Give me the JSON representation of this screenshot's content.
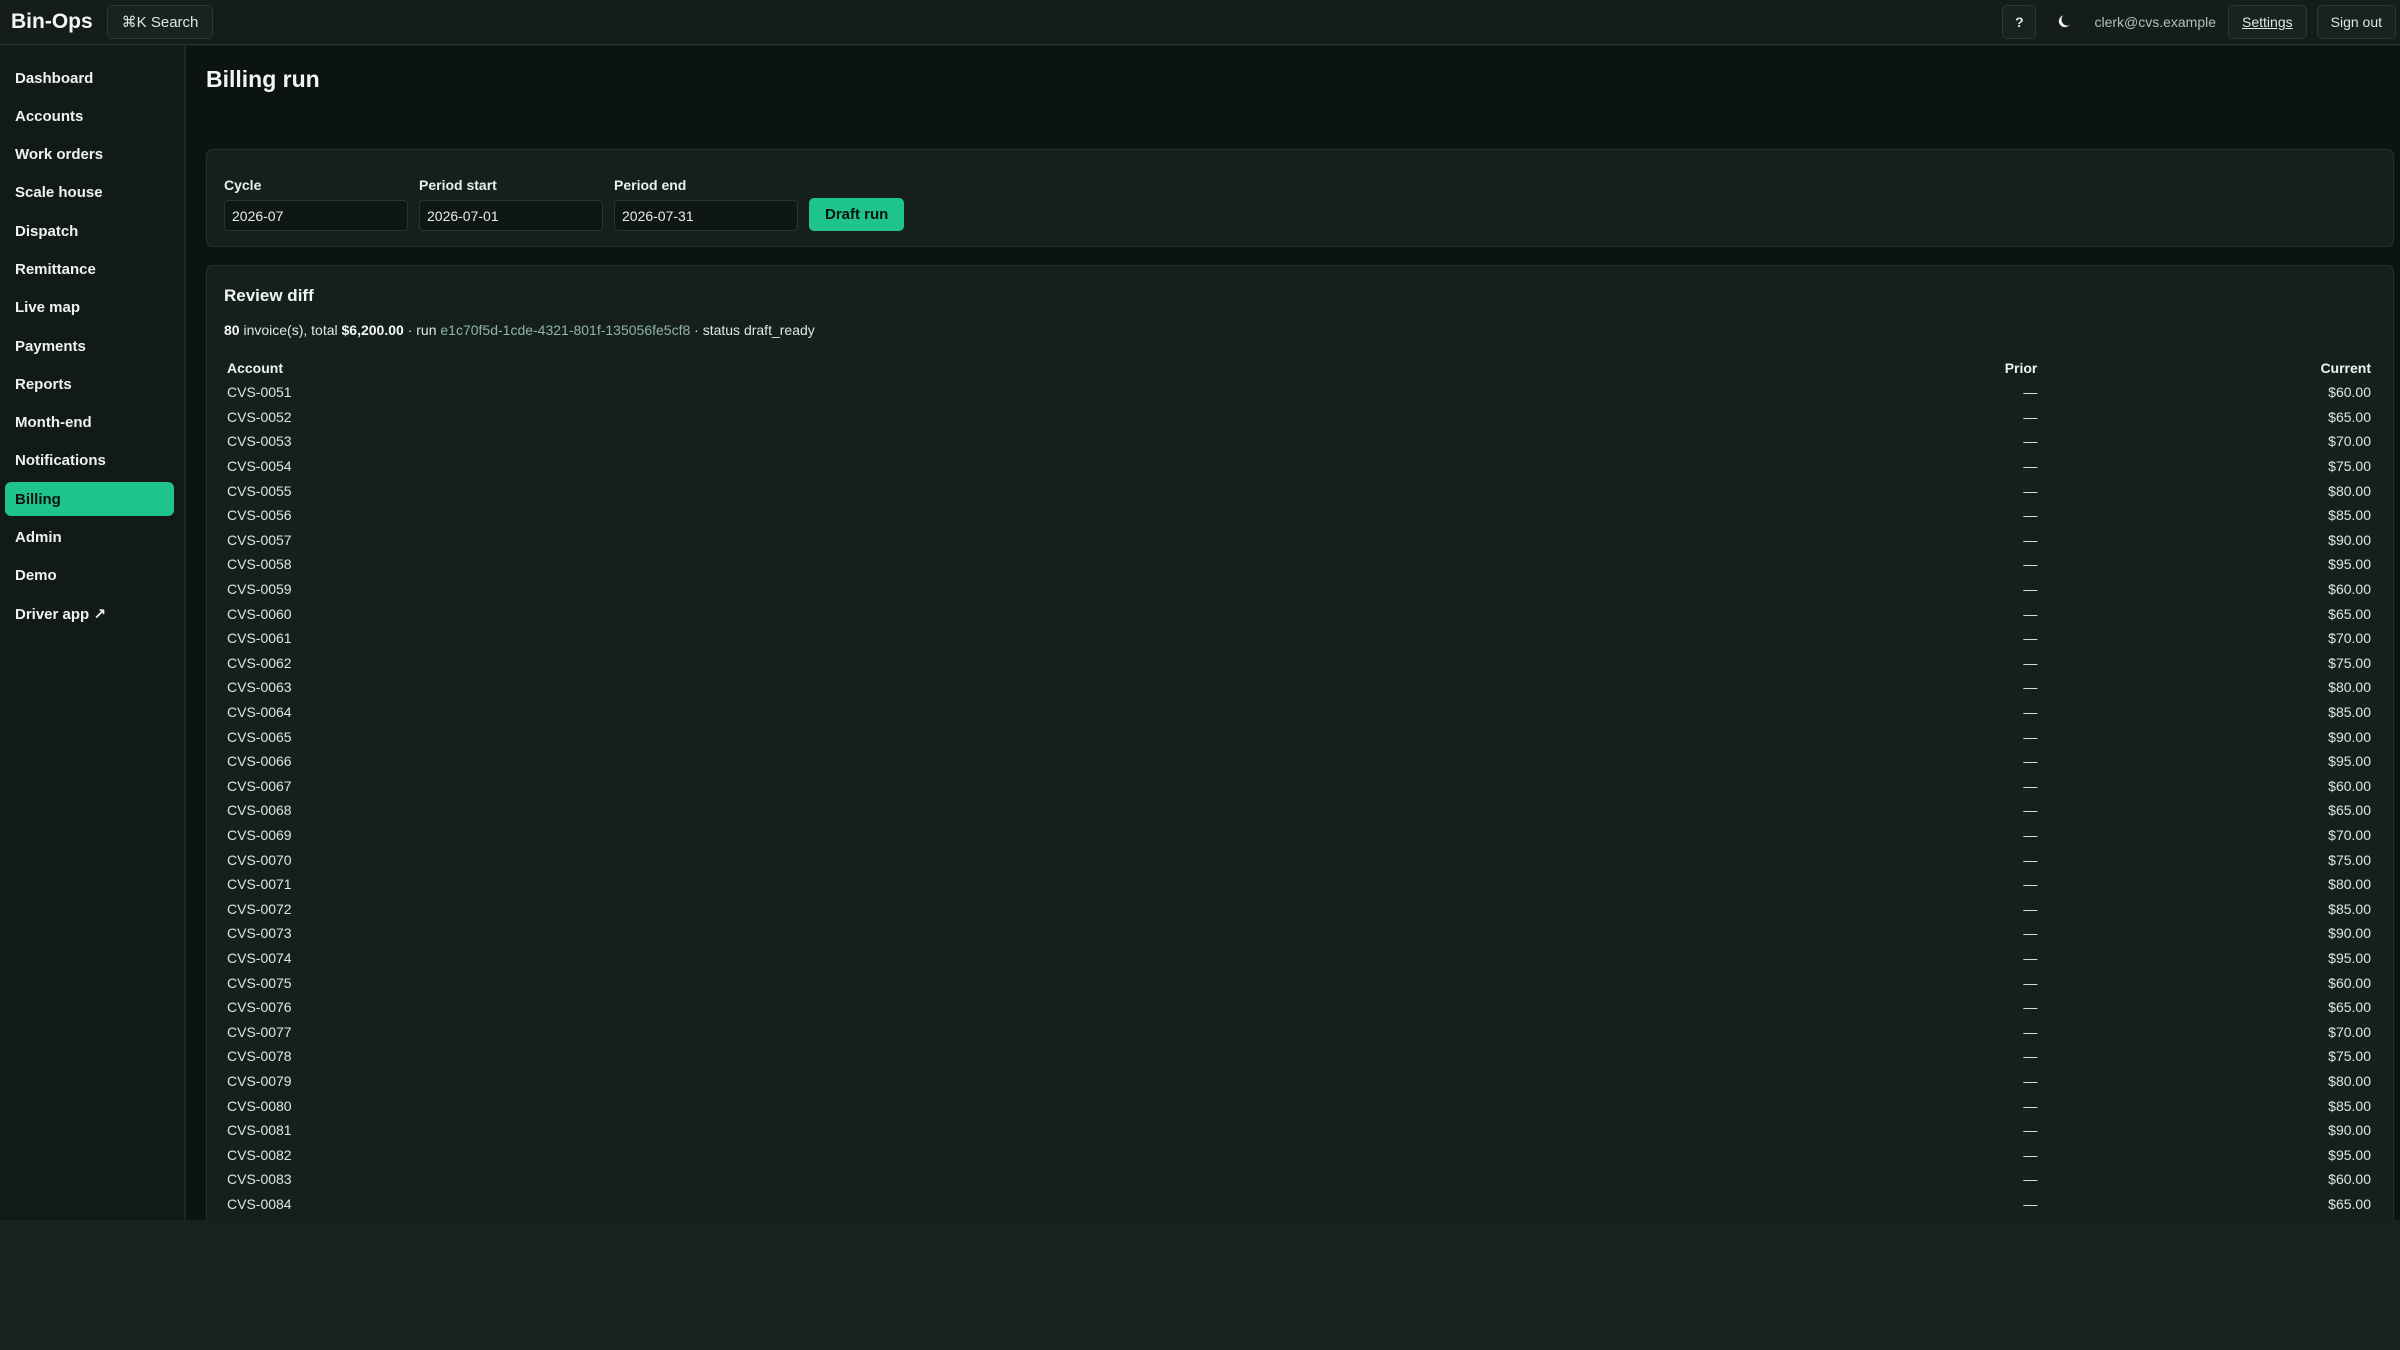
{
  "app": {
    "brand": "Bin-Ops"
  },
  "topbar": {
    "search_label": "⌘K Search",
    "help_label": "?",
    "user_email": "clerk@cvs.example",
    "settings_label": "Settings",
    "signout_label": "Sign out"
  },
  "sidebar": {
    "items": [
      {
        "label": "Dashboard",
        "active": false
      },
      {
        "label": "Accounts",
        "active": false
      },
      {
        "label": "Work orders",
        "active": false
      },
      {
        "label": "Scale house",
        "active": false
      },
      {
        "label": "Dispatch",
        "active": false
      },
      {
        "label": "Remittance",
        "active": false
      },
      {
        "label": "Live map",
        "active": false
      },
      {
        "label": "Payments",
        "active": false
      },
      {
        "label": "Reports",
        "active": false
      },
      {
        "label": "Month-end",
        "active": false
      },
      {
        "label": "Notifications",
        "active": false
      },
      {
        "label": "Billing",
        "active": true
      },
      {
        "label": "Admin",
        "active": false
      },
      {
        "label": "Demo",
        "active": false
      },
      {
        "label": "Driver app ↗",
        "active": false
      }
    ]
  },
  "page": {
    "title": "Billing run"
  },
  "form": {
    "cycle": {
      "label": "Cycle",
      "value": "2026-07"
    },
    "period_start": {
      "label": "Period start",
      "value": "2026-07-01"
    },
    "period_end": {
      "label": "Period end",
      "value": "2026-07-31"
    },
    "submit_label": "Draft run"
  },
  "review": {
    "title": "Review diff",
    "invoice_count": "80",
    "invoice_text": "invoice(s), total",
    "total": "$6,200.00",
    "run_prefix": "· run",
    "run_id": "e1c70f5d-1cde-4321-801f-135056fe5cf8",
    "status_text": "· status draft_ready",
    "columns": {
      "account": "Account",
      "prior": "Prior",
      "current": "Current"
    },
    "rows": [
      {
        "account": "CVS-0051",
        "prior": "—",
        "current": "$60.00"
      },
      {
        "account": "CVS-0052",
        "prior": "—",
        "current": "$65.00"
      },
      {
        "account": "CVS-0053",
        "prior": "—",
        "current": "$70.00"
      },
      {
        "account": "CVS-0054",
        "prior": "—",
        "current": "$75.00"
      },
      {
        "account": "CVS-0055",
        "prior": "—",
        "current": "$80.00"
      },
      {
        "account": "CVS-0056",
        "prior": "—",
        "current": "$85.00"
      },
      {
        "account": "CVS-0057",
        "prior": "—",
        "current": "$90.00"
      },
      {
        "account": "CVS-0058",
        "prior": "—",
        "current": "$95.00"
      },
      {
        "account": "CVS-0059",
        "prior": "—",
        "current": "$60.00"
      },
      {
        "account": "CVS-0060",
        "prior": "—",
        "current": "$65.00"
      },
      {
        "account": "CVS-0061",
        "prior": "—",
        "current": "$70.00"
      },
      {
        "account": "CVS-0062",
        "prior": "—",
        "current": "$75.00"
      },
      {
        "account": "CVS-0063",
        "prior": "—",
        "current": "$80.00"
      },
      {
        "account": "CVS-0064",
        "prior": "—",
        "current": "$85.00"
      },
      {
        "account": "CVS-0065",
        "prior": "—",
        "current": "$90.00"
      },
      {
        "account": "CVS-0066",
        "prior": "—",
        "current": "$95.00"
      },
      {
        "account": "CVS-0067",
        "prior": "—",
        "current": "$60.00"
      },
      {
        "account": "CVS-0068",
        "prior": "—",
        "current": "$65.00"
      },
      {
        "account": "CVS-0069",
        "prior": "—",
        "current": "$70.00"
      },
      {
        "account": "CVS-0070",
        "prior": "—",
        "current": "$75.00"
      },
      {
        "account": "CVS-0071",
        "prior": "—",
        "current": "$80.00"
      },
      {
        "account": "CVS-0072",
        "prior": "—",
        "current": "$85.00"
      },
      {
        "account": "CVS-0073",
        "prior": "—",
        "current": "$90.00"
      },
      {
        "account": "CVS-0074",
        "prior": "—",
        "current": "$95.00"
      },
      {
        "account": "CVS-0075",
        "prior": "—",
        "current": "$60.00"
      },
      {
        "account": "CVS-0076",
        "prior": "—",
        "current": "$65.00"
      },
      {
        "account": "CVS-0077",
        "prior": "—",
        "current": "$70.00"
      },
      {
        "account": "CVS-0078",
        "prior": "—",
        "current": "$75.00"
      },
      {
        "account": "CVS-0079",
        "prior": "—",
        "current": "$80.00"
      },
      {
        "account": "CVS-0080",
        "prior": "—",
        "current": "$85.00"
      },
      {
        "account": "CVS-0081",
        "prior": "—",
        "current": "$90.00"
      },
      {
        "account": "CVS-0082",
        "prior": "—",
        "current": "$95.00"
      },
      {
        "account": "CVS-0083",
        "prior": "—",
        "current": "$60.00"
      },
      {
        "account": "CVS-0084",
        "prior": "—",
        "current": "$65.00"
      }
    ]
  },
  "icons": {
    "theme_toggle": "moon-icon"
  },
  "colors": {
    "accent": "#1fc48d",
    "background": "#0c1412",
    "sidebar": "#111a18",
    "card": "#15201d",
    "run_id": "#8fb4a8"
  }
}
